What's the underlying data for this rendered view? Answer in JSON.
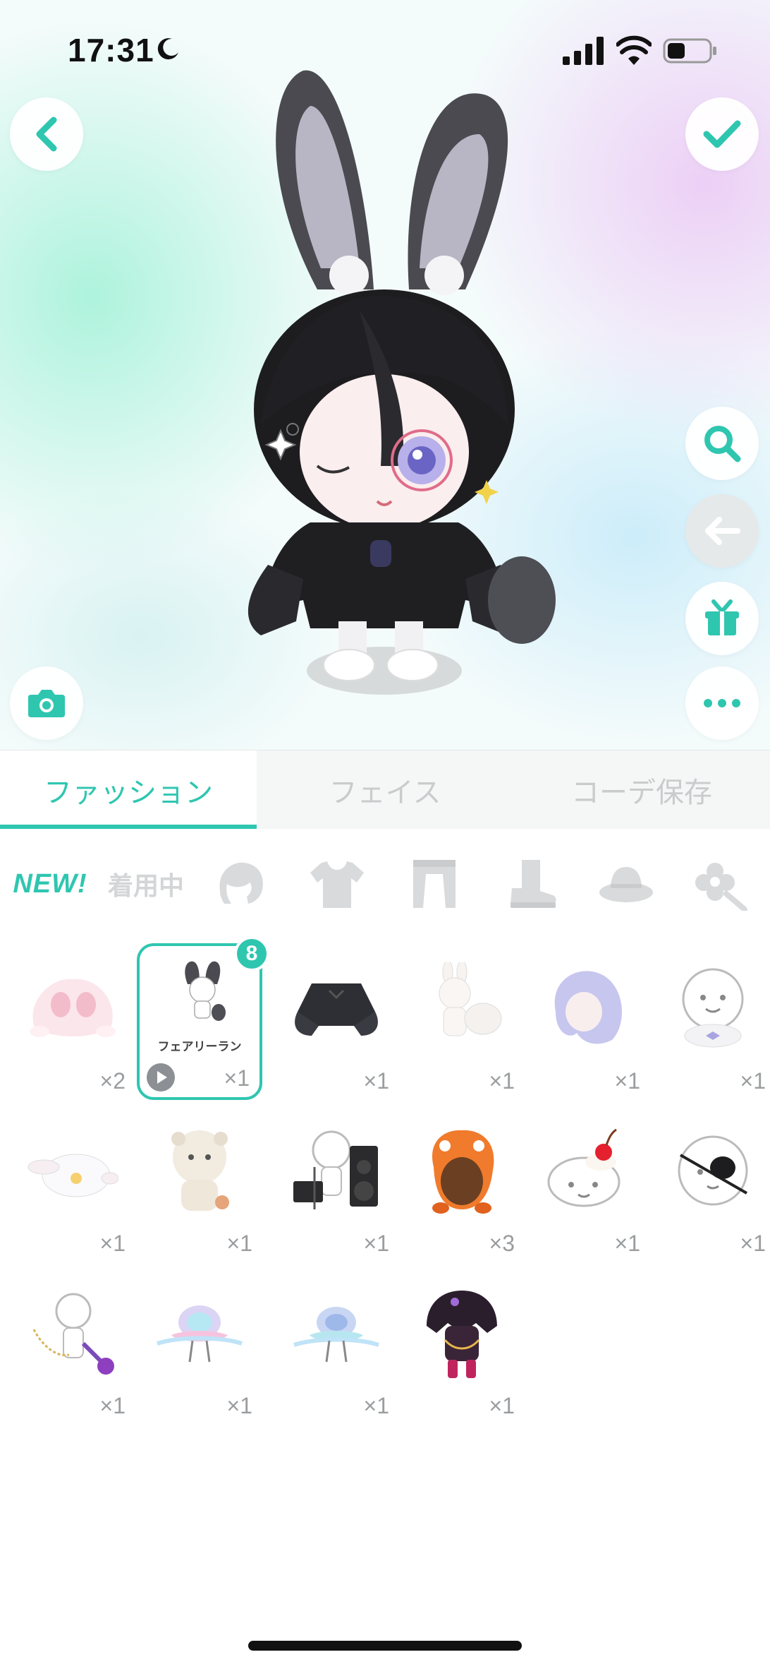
{
  "status_bar": {
    "time": "17:31",
    "moon_icon": "moon-icon",
    "signal_icon": "cellular-signal-icon",
    "wifi_icon": "wifi-icon",
    "battery_icon": "battery-icon"
  },
  "stage": {
    "back_icon": "chevron-left-icon",
    "confirm_icon": "checkmark-icon",
    "search_icon": "magnifier-icon",
    "undo_icon": "arrow-left-icon",
    "gift_icon": "gift-box-icon",
    "more_icon": "ellipsis-icon",
    "camera_icon": "camera-icon"
  },
  "tabs": [
    {
      "label": "ファッション",
      "active": true
    },
    {
      "label": "フェイス",
      "active": false
    },
    {
      "label": "コーデ保存",
      "active": false
    }
  ],
  "categories": {
    "new_label": "NEW!",
    "wearing_label": "着用中",
    "icons": [
      "hair-icon",
      "tshirt-icon",
      "bottoms-icon",
      "boots-icon",
      "hat-icon",
      "accessory-icon"
    ]
  },
  "items": [
    {
      "name": "pink-bunny-hood",
      "count": "×2"
    },
    {
      "name": "fairy-run-set",
      "count": "×1",
      "label": "フェアリーラン",
      "badge": "8",
      "selected": true
    },
    {
      "name": "black-frill-top",
      "count": "×1"
    },
    {
      "name": "white-bunny-costume",
      "count": "×1"
    },
    {
      "name": "lavender-wig",
      "count": "×1"
    },
    {
      "name": "fluffy-collar-bow",
      "count": "×1"
    },
    {
      "name": "cinnamon-bunny-pet",
      "count": "×1"
    },
    {
      "name": "bear-costume",
      "count": "×1"
    },
    {
      "name": "speaker-stage-set",
      "count": "×1"
    },
    {
      "name": "orange-monster-hood",
      "count": "×3"
    },
    {
      "name": "cherry-cream-hat",
      "count": "×1"
    },
    {
      "name": "eye-patch",
      "count": "×1"
    },
    {
      "name": "star-wand-chain",
      "count": "×1"
    },
    {
      "name": "jellyfish-dress-pink",
      "count": "×1"
    },
    {
      "name": "jellyfish-dress-blue",
      "count": "×1"
    },
    {
      "name": "dark-crow-outfit",
      "count": "×1"
    }
  ],
  "colors": {
    "accent": "#2fc6b0",
    "inactive": "#c9cccd"
  }
}
